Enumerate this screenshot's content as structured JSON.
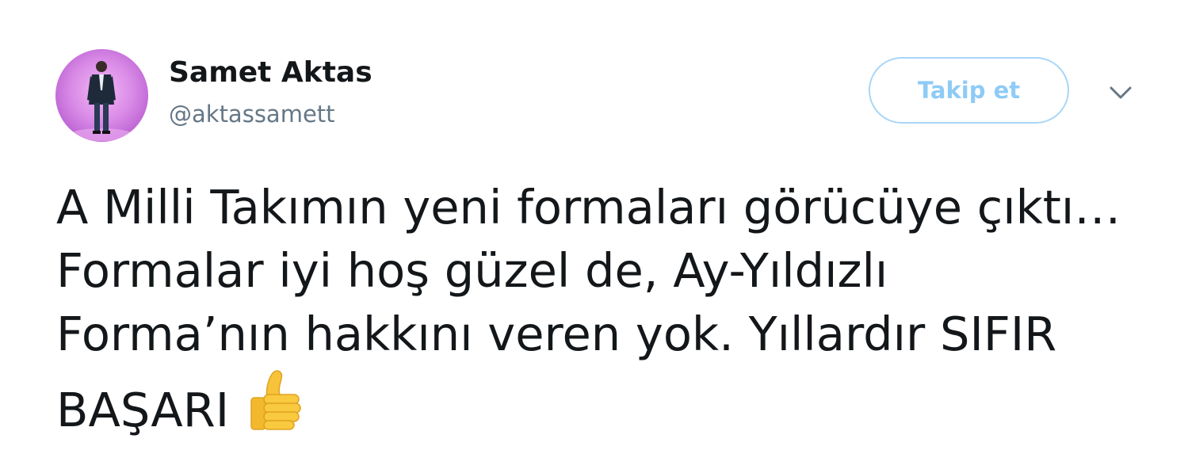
{
  "user": {
    "display_name": "Samet Aktas",
    "handle": "@aktassamett"
  },
  "actions": {
    "follow_label": "Takip et"
  },
  "tweet": {
    "lines": [
      "A Milli Takımın yeni formaları görücüye çıktı…",
      "Formalar iyi hoş güzel de, Ay-Yıldızlı",
      "Forma’nın hakkını veren yok. Yıllardır SIFIR",
      "BAŞARI"
    ],
    "emoji": "thumbs-up-icon"
  },
  "colors": {
    "follow_border": "#a9d6f7",
    "follow_text": "#8ecbf6",
    "handle_text": "#657786",
    "body_text": "#14171a",
    "avatar_bg": "#d98ae6"
  }
}
